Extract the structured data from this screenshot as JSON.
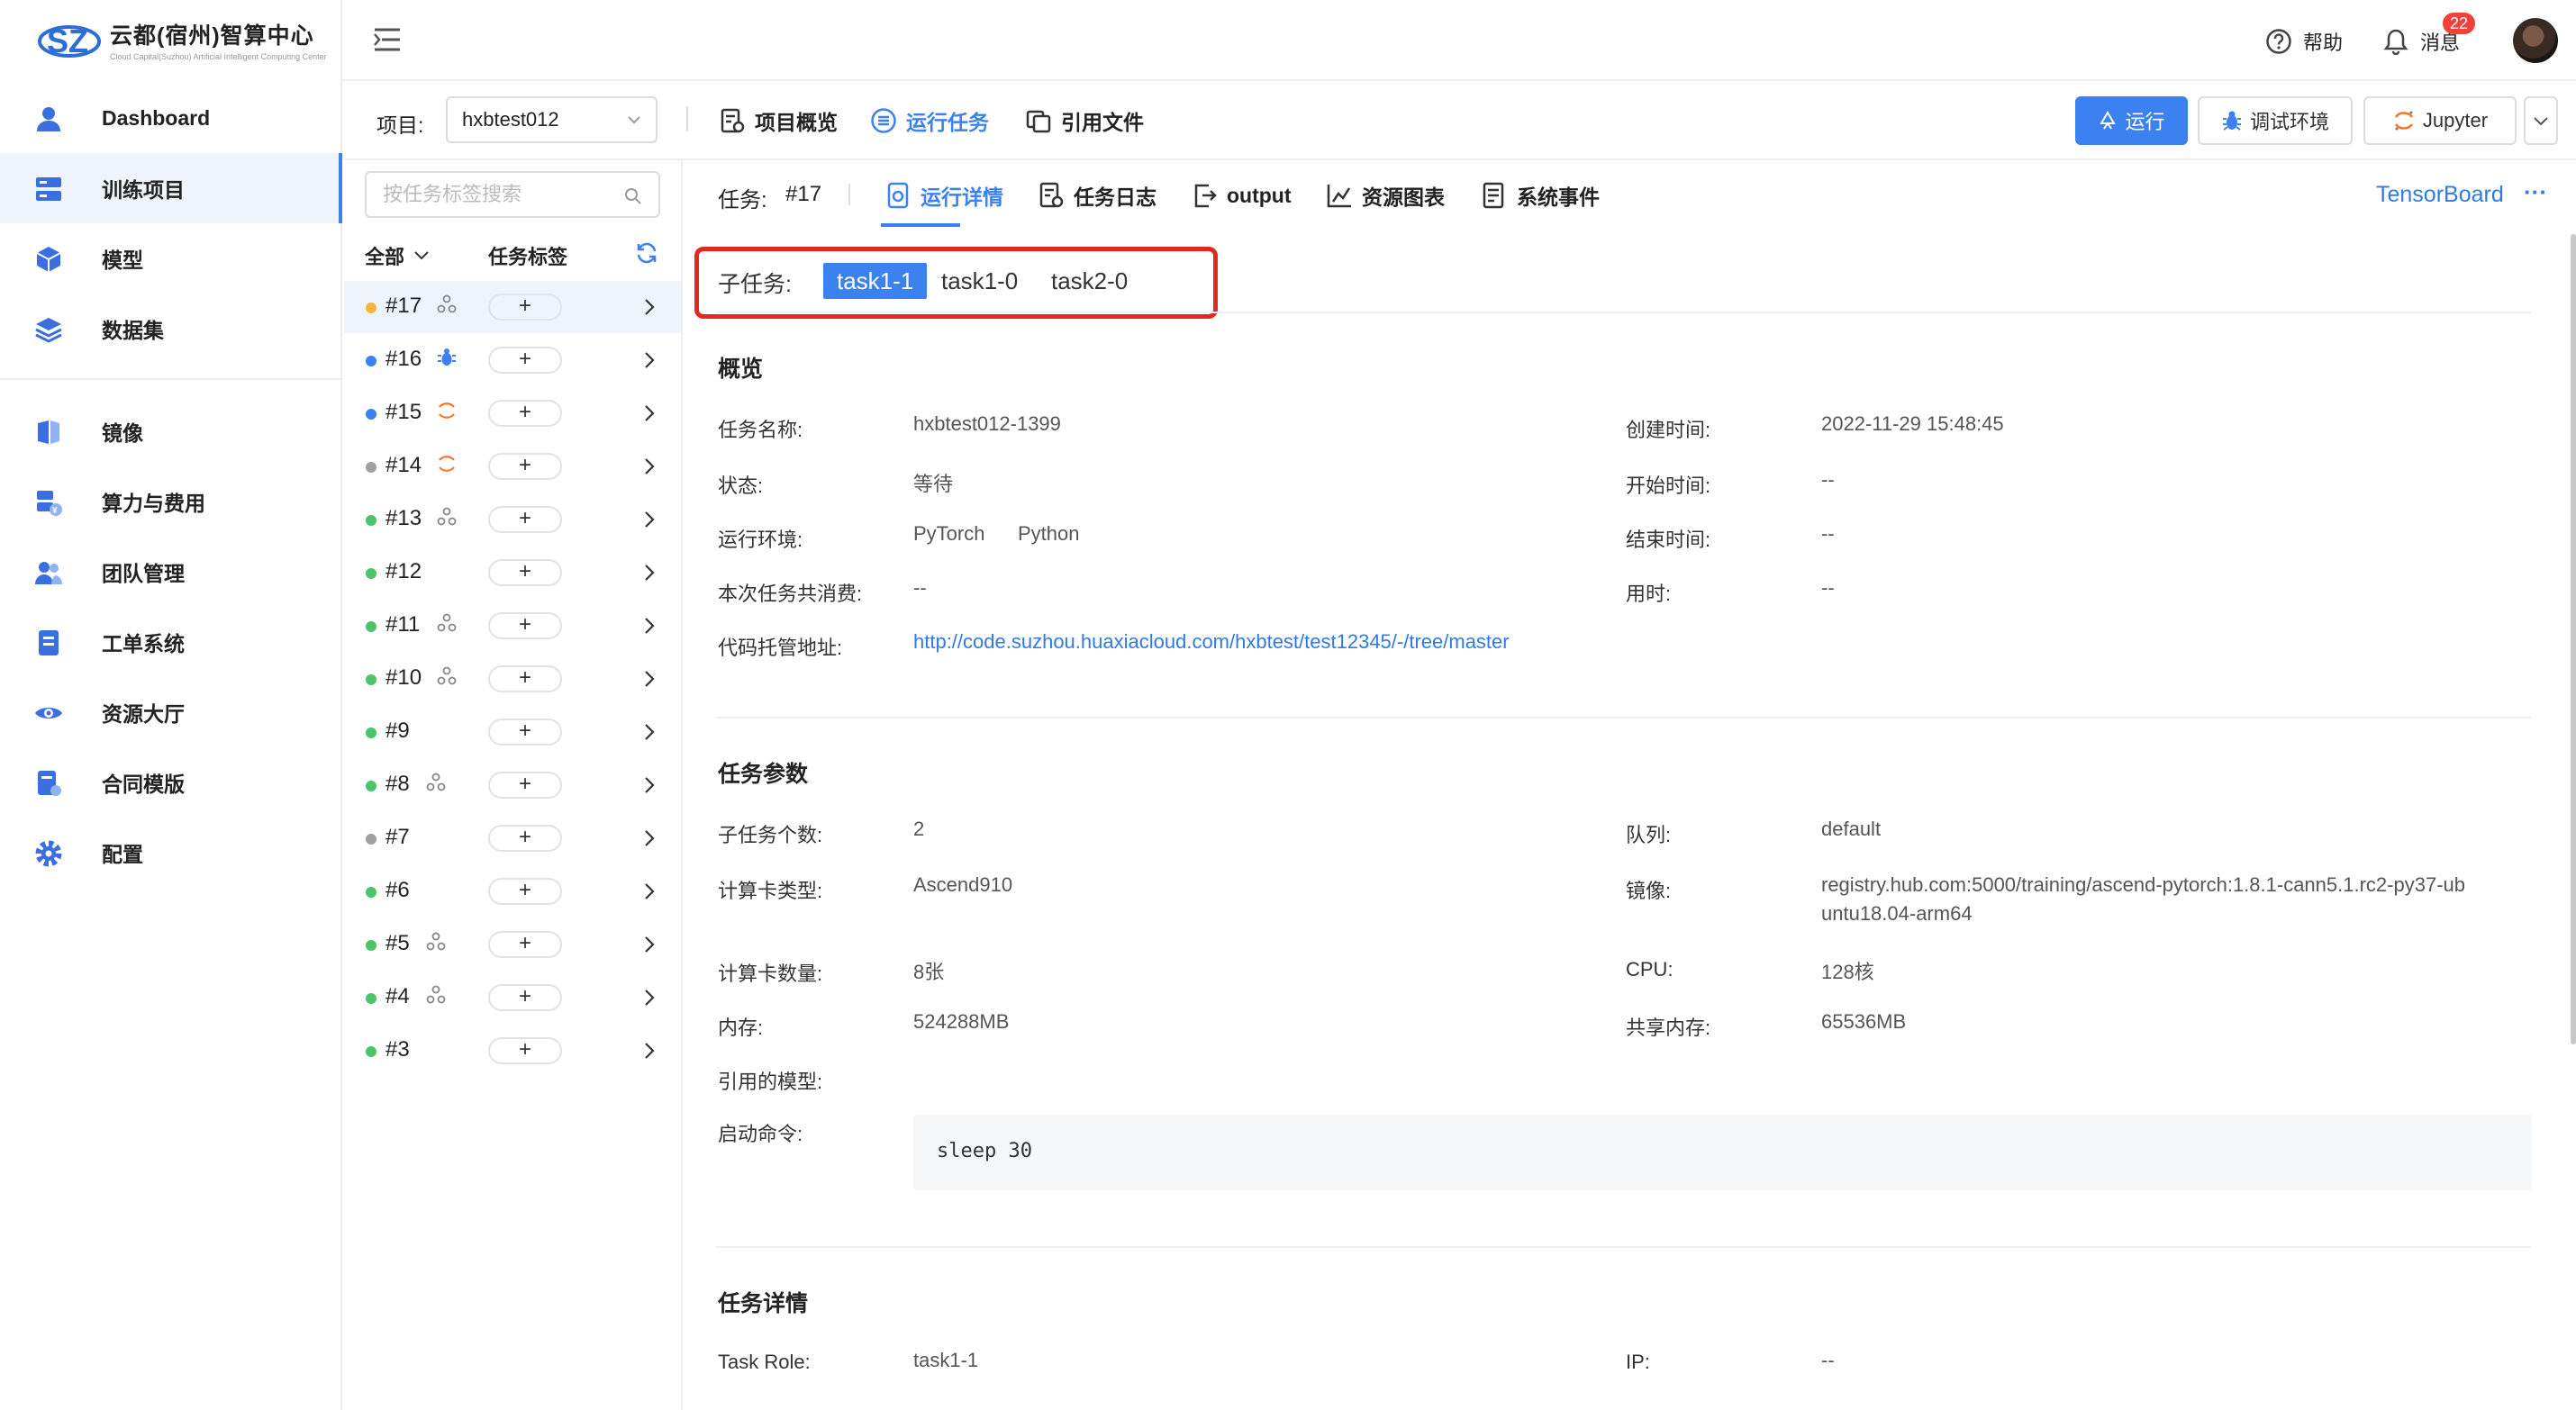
{
  "app": {
    "logo_title": "云都(宿州)智算中心",
    "logo_subtitle": "Cloud Capital(Suzhou) Artificial Intelligent Computing Center"
  },
  "sidebar": {
    "items": [
      {
        "label": "Dashboard",
        "icon": "user-icon"
      },
      {
        "label": "训练项目",
        "icon": "server-icon",
        "active": true
      },
      {
        "label": "模型",
        "icon": "cube-icon"
      },
      {
        "label": "数据集",
        "icon": "layers-icon"
      },
      {
        "label": "镜像",
        "icon": "mirror-icon"
      },
      {
        "label": "算力与费用",
        "icon": "compute-cost-icon"
      },
      {
        "label": "团队管理",
        "icon": "team-icon"
      },
      {
        "label": "工单系统",
        "icon": "ticket-icon"
      },
      {
        "label": "资源大厅",
        "icon": "eye-icon"
      },
      {
        "label": "合同模版",
        "icon": "contract-icon"
      },
      {
        "label": "配置",
        "icon": "gear-icon"
      }
    ]
  },
  "header": {
    "help": "帮助",
    "messages": "消息",
    "message_count": "22"
  },
  "toolbar": {
    "project_label": "项目:",
    "project_value": "hxbtest012",
    "tabs": [
      {
        "label": "项目概览",
        "icon": "overview-icon"
      },
      {
        "label": "运行任务",
        "icon": "list-icon",
        "active": true
      },
      {
        "label": "引用文件",
        "icon": "files-icon"
      }
    ],
    "run_button": "运行",
    "debug_button": "调试环境",
    "jupyter_button": "Jupyter"
  },
  "tasklist": {
    "search_placeholder": "按任务标签搜索",
    "filter_label": "全部",
    "tag_header": "任务标签",
    "plus": "+",
    "tasks": [
      {
        "id": "#17",
        "status_color": "#f5b53a",
        "icon": "cluster-icon"
      },
      {
        "id": "#16",
        "status_color": "#3b82f0",
        "icon": "bug-icon"
      },
      {
        "id": "#15",
        "status_color": "#3b82f0",
        "icon": "jupyter-icon"
      },
      {
        "id": "#14",
        "status_color": "#a0a0a0",
        "icon": "jupyter-icon"
      },
      {
        "id": "#13",
        "status_color": "#4cc469",
        "icon": "cluster-icon"
      },
      {
        "id": "#12",
        "status_color": "#4cc469",
        "icon": ""
      },
      {
        "id": "#11",
        "status_color": "#4cc469",
        "icon": "cluster-icon"
      },
      {
        "id": "#10",
        "status_color": "#4cc469",
        "icon": "cluster-icon"
      },
      {
        "id": "#9",
        "status_color": "#4cc469",
        "icon": ""
      },
      {
        "id": "#8",
        "status_color": "#4cc469",
        "icon": "cluster-icon"
      },
      {
        "id": "#7",
        "status_color": "#a0a0a0",
        "icon": ""
      },
      {
        "id": "#6",
        "status_color": "#4cc469",
        "icon": ""
      },
      {
        "id": "#5",
        "status_color": "#4cc469",
        "icon": "cluster-icon"
      },
      {
        "id": "#4",
        "status_color": "#4cc469",
        "icon": "cluster-icon"
      },
      {
        "id": "#3",
        "status_color": "#4cc469",
        "icon": ""
      }
    ]
  },
  "detail": {
    "task_label": "任务:",
    "task_id": "#17",
    "tabs": [
      {
        "label": "运行详情",
        "icon": "detail-icon",
        "active": true
      },
      {
        "label": "任务日志",
        "icon": "log-icon"
      },
      {
        "label": "output",
        "icon": "output-icon"
      },
      {
        "label": "资源图表",
        "icon": "chart-icon"
      },
      {
        "label": "系统事件",
        "icon": "event-icon"
      }
    ],
    "tensorboard": "TensorBoard",
    "more": "···",
    "subtask_label": "子任务:",
    "subtasks": [
      "task1-1",
      "task1-0",
      "task2-0"
    ],
    "overview": {
      "title": "概览",
      "name_k": "任务名称:",
      "name_v": "hxbtest012-1399",
      "created_k": "创建时间:",
      "created_v": "2022-11-29 15:48:45",
      "status_k": "状态:",
      "status_v": "等待",
      "start_k": "开始时间:",
      "start_v": "--",
      "env_k": "运行环境:",
      "env_v1": "PyTorch",
      "env_v2": "Python",
      "end_k": "结束时间:",
      "end_v": "--",
      "cost_k": "本次任务共消费:",
      "cost_v": "--",
      "duration_k": "用时:",
      "duration_v": "--",
      "repo_k": "代码托管地址:",
      "repo_v": "http://code.suzhou.huaxiacloud.com/hxbtest/test12345/-/tree/master"
    },
    "params": {
      "title": "任务参数",
      "subcount_k": "子任务个数:",
      "subcount_v": "2",
      "queue_k": "队列:",
      "queue_v": "default",
      "cardtype_k": "计算卡类型:",
      "cardtype_v": "Ascend910",
      "image_k": "镜像:",
      "image_v1": "registry.hub.com:5000/training/ascend-pytorch:1.8.1-cann5.1.rc2-py37-ub",
      "image_v2": "untu18.04-arm64",
      "cardnum_k": "计算卡数量:",
      "cardnum_v": "8张",
      "cpu_k": "CPU:",
      "cpu_v": "128核",
      "mem_k": "内存:",
      "mem_v": "524288MB",
      "shm_k": "共享内存:",
      "shm_v": "65536MB",
      "model_k": "引用的模型:",
      "cmd_k": "启动命令:",
      "cmd_v": "sleep 30"
    },
    "taskinfo": {
      "title": "任务详情",
      "role_k": "Task Role:",
      "role_v": "task1-1",
      "ip_k": "IP:",
      "ip_v": "--"
    }
  }
}
